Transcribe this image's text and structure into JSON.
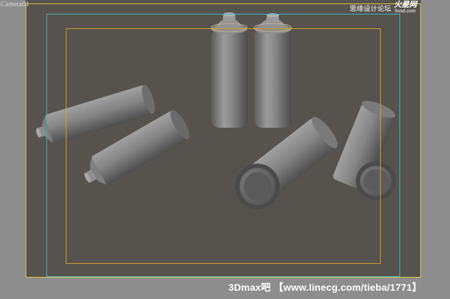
{
  "viewport": {
    "label": "Camera01"
  },
  "objects": [
    {
      "name": "spray-can-standing-left",
      "kind": "spray can",
      "pose": "standing"
    },
    {
      "name": "spray-can-standing-right",
      "kind": "spray can",
      "pose": "standing"
    },
    {
      "name": "spray-can-lying-top-left",
      "kind": "spray can",
      "pose": "lying"
    },
    {
      "name": "spray-can-lying-middle-left",
      "kind": "spray can",
      "pose": "lying"
    },
    {
      "name": "spray-can-lying-center",
      "kind": "spray can",
      "pose": "lying"
    },
    {
      "name": "spray-can-lying-right",
      "kind": "spray can",
      "pose": "lying"
    }
  ],
  "watermarks": {
    "top_right_text": "思缘设计论坛",
    "top_right_logo": "火星网",
    "top_right_url": "hxsd.com",
    "bottom": "3Dmax吧 【www.linecg.com/tieba/1771】"
  },
  "colors": {
    "viewport_background": "#56524d",
    "outer_border": "#8d8d8d",
    "safe_frame_live": "#e6c74a",
    "safe_frame_action": "#3fb8c8",
    "safe_frame_title": "#d4a028",
    "object_shade": "#7a7a7a"
  }
}
